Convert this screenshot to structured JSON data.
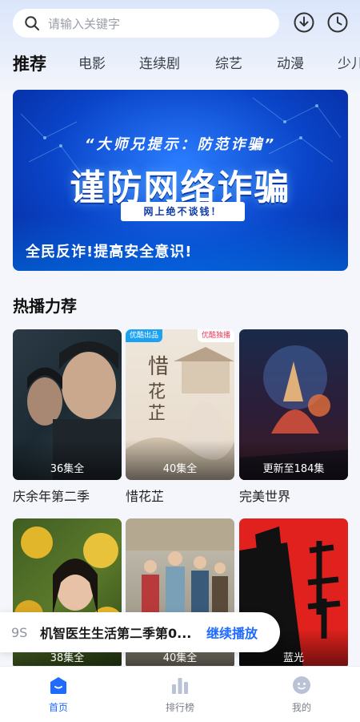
{
  "search": {
    "placeholder": "请输入关键字"
  },
  "header_icons": [
    "download-icon",
    "history-clock-icon"
  ],
  "tabs": [
    {
      "label": "推荐",
      "active": true
    },
    {
      "label": "电影"
    },
    {
      "label": "连续剧"
    },
    {
      "label": "综艺"
    },
    {
      "label": "动漫"
    },
    {
      "label": "少儿"
    }
  ],
  "banner": {
    "subtitle": "“大师兄提示：防范诈骗”",
    "title": "谨防网络诈骗",
    "pill": "网上绝不谈钱！",
    "bottom": "全民反诈!提高安全意识!"
  },
  "section": {
    "title": "热播力荐"
  },
  "cards": [
    {
      "title": "庆余年第二季",
      "episodes": "36集全"
    },
    {
      "title": "惜花芷",
      "episodes": "40集全",
      "badge_left": "优酷出品",
      "badge_right": "优酷独播"
    },
    {
      "title": "完美世界",
      "episodes": "更新至184集"
    },
    {
      "title": "",
      "episodes": "38集全"
    },
    {
      "title": "",
      "episodes": "40集全"
    },
    {
      "title": "",
      "episodes": "蓝光"
    }
  ],
  "continue_play": {
    "time": "9S",
    "title": "机智医生生活第二季第0...",
    "button": "继续播放"
  },
  "nav": [
    {
      "label": "首页",
      "active": true,
      "icon": "home-icon"
    },
    {
      "label": "排行榜",
      "icon": "ranking-icon"
    },
    {
      "label": "我的",
      "icon": "profile-icon"
    }
  ],
  "colors": {
    "accent": "#1f6bff",
    "banner": "#0a44c8"
  }
}
